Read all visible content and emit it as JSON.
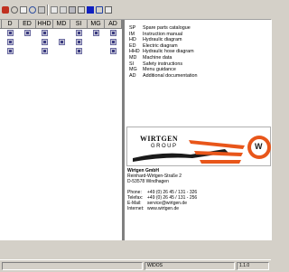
{
  "grid": {
    "headers": [
      "D",
      "ED",
      "HHD",
      "MD",
      "SI",
      "MG",
      "AD"
    ],
    "rows": [
      [
        true,
        true,
        true,
        false,
        true,
        true,
        true
      ],
      [
        true,
        false,
        true,
        true,
        true,
        false,
        true
      ],
      [
        true,
        false,
        true,
        false,
        true,
        false,
        true
      ]
    ]
  },
  "legend": [
    {
      "code": "SP",
      "label": "Spare parts catalogue"
    },
    {
      "code": "IM",
      "label": "Instruction manual"
    },
    {
      "code": "HD",
      "label": "Hydraulic diagram"
    },
    {
      "code": "ED",
      "label": "Electric diagram"
    },
    {
      "code": "HHD",
      "label": "Hydraulic hose diagram"
    },
    {
      "code": "MD",
      "label": "Machine data"
    },
    {
      "code": "SI",
      "label": "Safety instructions"
    },
    {
      "code": "MG",
      "label": "Menu guidance"
    },
    {
      "code": "AD",
      "label": "Additional documentation"
    }
  ],
  "logo": {
    "word": "WIRTGEN",
    "group": "GROUP",
    "mark": "W"
  },
  "contact": {
    "company": "Wirtgen GmbH",
    "street": "Reinhard-Wirtgen-Straße 2",
    "city": "D-53578 Windhagen",
    "rows": [
      {
        "label": "Phone:",
        "value": "+49 (0) 26 45 / 131 - 326"
      },
      {
        "label": "Telefax:",
        "value": "+49 (0) 26 45 / 131 - 256"
      },
      {
        "label": "E-Mail:",
        "value": "service@wirtgen.de"
      },
      {
        "label": "Internet:",
        "value": "www.wirtgen.de"
      }
    ]
  },
  "status": {
    "center": "WIDOS",
    "right": "1.1.0"
  },
  "colors": {
    "logo_orange": "#e8561a",
    "logo_black": "#1a1a1a"
  }
}
